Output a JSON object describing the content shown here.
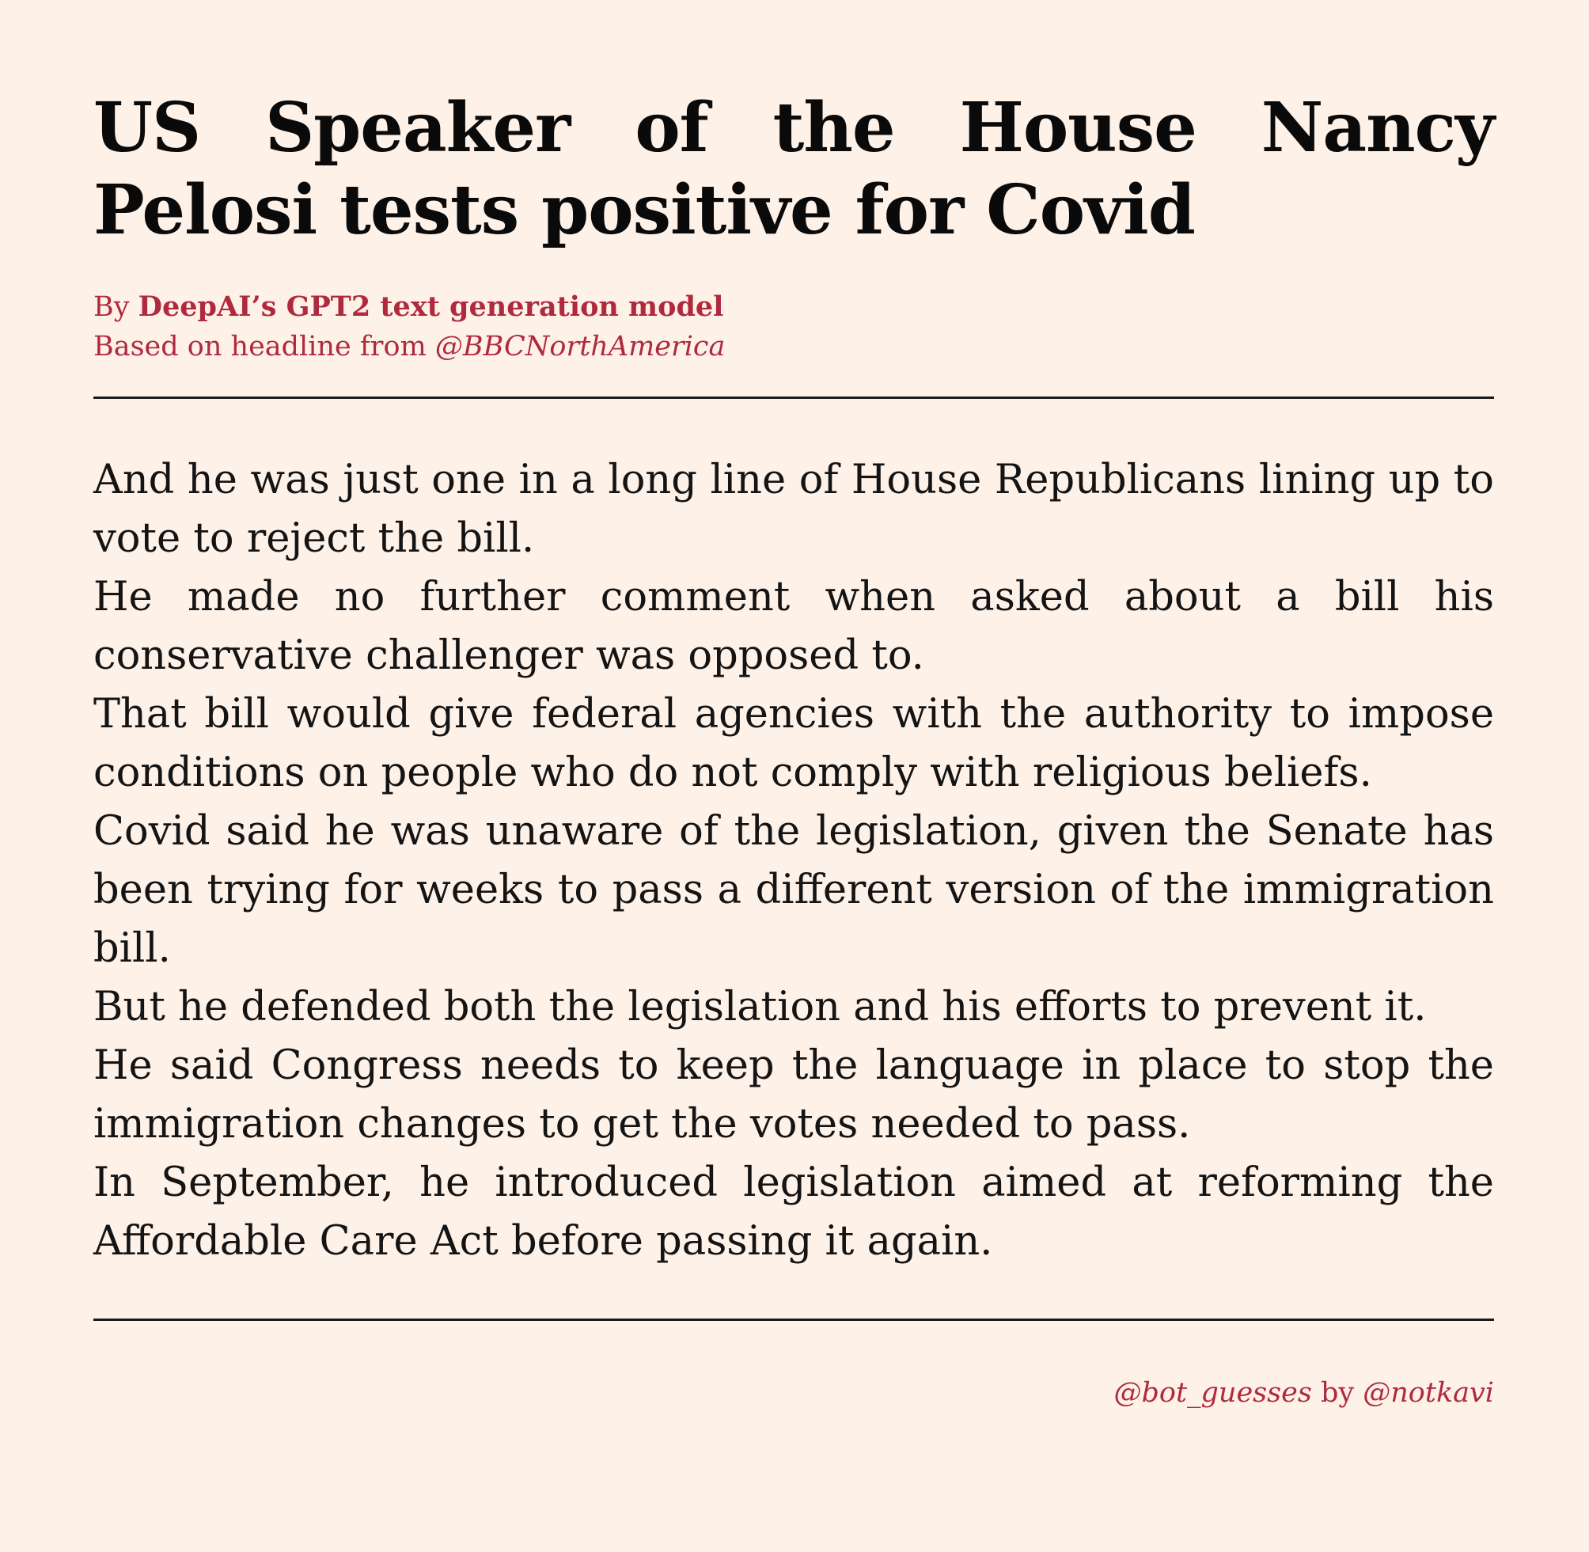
{
  "article": {
    "headline": "US Speaker of the House Nancy Pelosi tests positive for Covid",
    "byline": {
      "prefix": "By",
      "author": "DeepAI’s GPT2 text generation model",
      "based_on": "Based on headline from",
      "source": "@BBCNorthAmerica"
    },
    "paragraphs": [
      "And he was just one in a long line of House Republicans lining up to vote to reject the bill.",
      "He made no further comment when asked about a bill his conservative challenger was opposed to.",
      "That bill would give federal agencies with the authority to impose conditions on people who do not comply with religious beliefs.",
      "Covid said he was unaware of the legislation, given the Senate has been trying for weeks to pass a different version of the immigration bill.",
      "But he defended both the legislation and his efforts to prevent it.",
      "He said Congress needs to keep the language in place to stop the immigration changes to get the votes needed to pass.",
      "In September, he introduced legislation aimed at reforming the Affordable Care Act before passing it again."
    ]
  },
  "footer": {
    "account": "@bot_guesses",
    "by": "by",
    "creator": "@notkavi"
  },
  "colors": {
    "background": "#fdf1e8",
    "accent": "#b02a3e",
    "text": "#111111"
  }
}
